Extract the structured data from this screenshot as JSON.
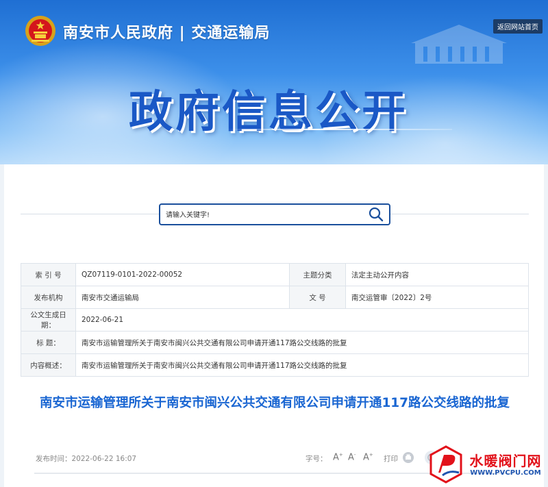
{
  "header": {
    "site_title": "南安市人民政府 | 交通运输局",
    "home_link": "返回网站首页",
    "hero_title": "政府信息公开"
  },
  "search": {
    "placeholder": "请输入关键字!"
  },
  "info": {
    "index_label": "索 引 号",
    "index_value": "QZ07119-0101-2022-00052",
    "category_label": "主题分类",
    "category_value": "法定主动公开内容",
    "publisher_label": "发布机构",
    "publisher_value": "南安市交通运输局",
    "docno_label": "文  号",
    "docno_value": "南交运管审〔2022〕2号",
    "date_label": "公文生成日期：",
    "date_value": "2022-06-21",
    "title_label": "标    题：",
    "title_value": "南安市运输管理所关于南安市闽兴公共交通有限公司申请开通117路公交线路的批复",
    "summary_label": "内容概述：",
    "summary_value": "南安市运输管理所关于南安市闽兴公共交通有限公司申请开通117路公交线路的批复"
  },
  "article": {
    "title": "南安市运输管理所关于南安市闽兴公共交通有限公司申请开通117路公交线路的批复",
    "publish_time": "发布时间：2022-06-22 16:07",
    "font_size_label": "字号：",
    "font_large": "A",
    "font_medium": "A",
    "font_small": "A",
    "font_large_mark": "+",
    "font_medium_mark": "-",
    "font_small_mark": "+",
    "print_label": "打印"
  },
  "watermark": {
    "name": "水暖阀门网",
    "url": "WWW.PVCPU.COM"
  },
  "colors": {
    "banner_blue": "#1f6fd3",
    "title_blue": "#1a66d2",
    "search_border": "#1a4f9c",
    "watermark_red": "#e2111a"
  },
  "icons": [
    "national-emblem-icon",
    "search-icon",
    "print-icon",
    "share-icon",
    "watermark-logo-icon"
  ]
}
